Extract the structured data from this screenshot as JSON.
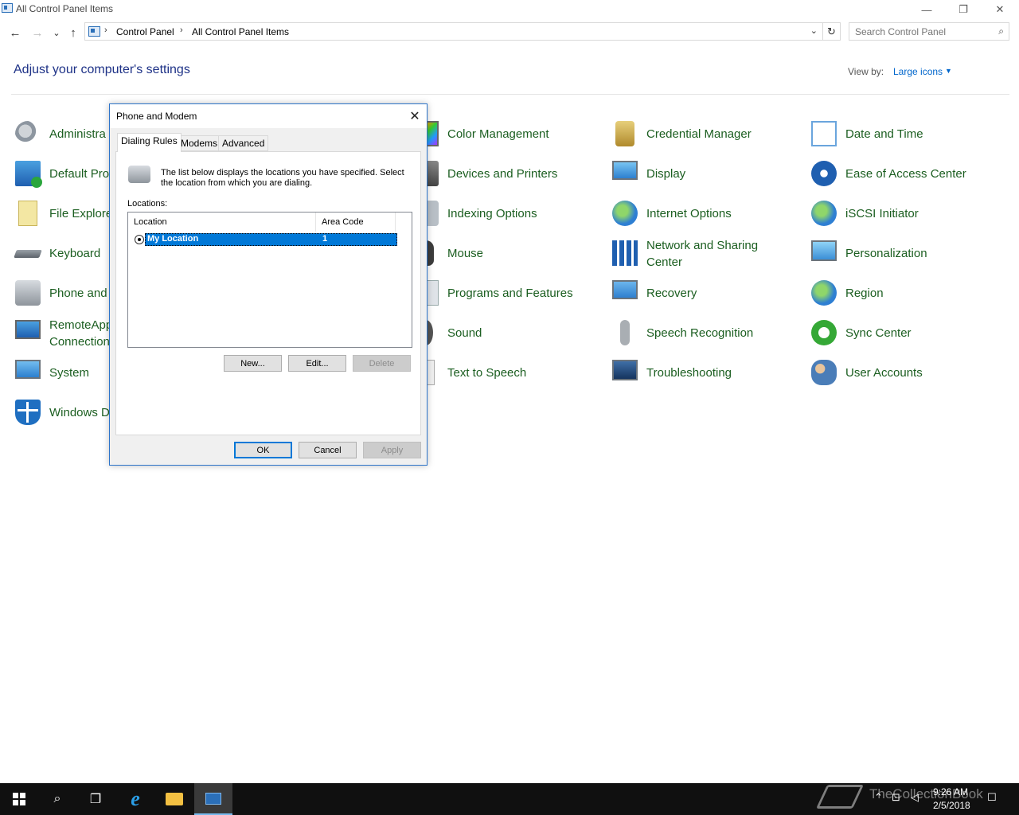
{
  "window": {
    "title": "All Control Panel Items",
    "minimize": "—",
    "restore": "❐",
    "close": "✕"
  },
  "nav": {
    "back": "←",
    "forward": "→",
    "recent": "⌄",
    "up": "↑",
    "breadcrumb": [
      "Control Panel",
      "All Control Panel Items"
    ],
    "separator": "›",
    "dropdown": "⌄",
    "refresh": "↻"
  },
  "search": {
    "placeholder": "Search Control Panel",
    "icon": "⌕"
  },
  "page": {
    "heading": "Adjust your computer's settings",
    "view_by_label": "View by:",
    "view_by_value": "Large icons",
    "view_by_caret": "▼"
  },
  "items": [
    {
      "label": "Administra",
      "icon": "admin-tools-icon"
    },
    {
      "label": "Default Pro",
      "icon": "default-programs-icon"
    },
    {
      "label": "File Explore",
      "icon": "file-explorer-options-icon"
    },
    {
      "label": "Keyboard",
      "icon": "keyboard-icon"
    },
    {
      "label": "Phone and",
      "icon": "phone-modem-icon"
    },
    {
      "label": "RemoteApp",
      "label2": "Connection",
      "icon": "remoteapp-icon"
    },
    {
      "label": "System",
      "icon": "system-icon"
    },
    {
      "label": "Windows D",
      "icon": "windows-defender-icon"
    },
    {
      "label": "Color Management",
      "icon": "color-management-icon"
    },
    {
      "label": "Devices and Printers",
      "icon": "printer-icon"
    },
    {
      "label": "Indexing Options",
      "icon": "indexing-icon"
    },
    {
      "label": "Mouse",
      "icon": "mouse-icon"
    },
    {
      "label": "Programs and Features",
      "icon": "programs-icon"
    },
    {
      "label": "Sound",
      "icon": "speaker-icon"
    },
    {
      "label": "Text to Speech",
      "icon": "text-to-speech-icon"
    },
    {
      "label": "Credential Manager",
      "icon": "credential-vault-icon"
    },
    {
      "label": "Display",
      "icon": "display-icon"
    },
    {
      "label": "Internet Options",
      "icon": "globe-icon"
    },
    {
      "label": "Network and Sharing",
      "label2": "Center",
      "icon": "network-icon"
    },
    {
      "label": "Recovery",
      "icon": "recovery-icon"
    },
    {
      "label": "Speech Recognition",
      "icon": "microphone-icon"
    },
    {
      "label": "Troubleshooting",
      "icon": "troubleshoot-icon"
    },
    {
      "label": "Date and Time",
      "icon": "calendar-clock-icon"
    },
    {
      "label": "Ease of Access Center",
      "icon": "ease-of-access-icon"
    },
    {
      "label": "iSCSI Initiator",
      "icon": "iscsi-globe-icon"
    },
    {
      "label": "Personalization",
      "icon": "personalization-icon"
    },
    {
      "label": "Region",
      "icon": "region-globe-icon"
    },
    {
      "label": "Sync Center",
      "icon": "sync-icon"
    },
    {
      "label": "User Accounts",
      "icon": "users-icon"
    }
  ],
  "dialog": {
    "title": "Phone and Modem",
    "close": "✕",
    "tabs": [
      "Dialing Rules",
      "Modems",
      "Advanced"
    ],
    "description": "The list below displays the locations you have specified. Select the location from which you are dialing.",
    "locations_label": "Locations:",
    "columns": [
      "Location",
      "Area Code"
    ],
    "rows": [
      {
        "location": "My Location",
        "area_code": "1"
      }
    ],
    "buttons": {
      "new": "New...",
      "edit": "Edit...",
      "delete": "Delete",
      "ok": "OK",
      "cancel": "Cancel",
      "apply": "Apply"
    }
  },
  "taskbar": {
    "search_icon": "⌕",
    "taskview_icon": "❐",
    "ie_letter": "e",
    "tray_up": "⌃",
    "tray_network": "⊡",
    "tray_volume": "◁",
    "tray_notify": "☐",
    "time": "9:26 AM",
    "date": "2/5/2018",
    "watermark": "TheCollectionBook"
  },
  "colors": {
    "heading": "#1e3287",
    "item_label": "#1b5e20",
    "link": "#0066cc",
    "selection": "#0078d7",
    "taskbar": "#101010"
  }
}
